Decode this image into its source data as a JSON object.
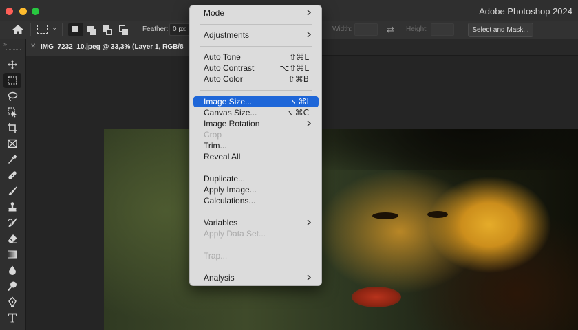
{
  "app": {
    "title": "Adobe Photoshop 2024"
  },
  "options_bar": {
    "feather_label": "Feather:",
    "feather_value": "0 px",
    "width_label": "Width:",
    "height_label": "Height:",
    "select_and_mask": "Select and Mask..."
  },
  "document": {
    "tab_title": "IMG_7232_10.jpeg @ 33,3% (Layer 1, RGB/8"
  },
  "toolbar": {
    "tools": [
      "move-tool",
      "rectangular-marquee-tool",
      "lasso-tool",
      "object-selection-tool",
      "crop-tool",
      "frame-tool",
      "eyedropper-tool",
      "spot-healing-brush-tool",
      "brush-tool",
      "clone-stamp-tool",
      "history-brush-tool",
      "eraser-tool",
      "gradient-tool",
      "blur-tool",
      "dodge-tool",
      "pen-tool",
      "type-tool"
    ],
    "active_tool": "rectangular-marquee-tool"
  },
  "menu": {
    "items": [
      {
        "label": "Mode",
        "submenu": true
      },
      {
        "label": "Adjustments",
        "submenu": true
      },
      {
        "label": "Auto Tone",
        "shortcut": "⇧⌘L"
      },
      {
        "label": "Auto Contrast",
        "shortcut": "⌥⇧⌘L"
      },
      {
        "label": "Auto Color",
        "shortcut": "⇧⌘B"
      },
      {
        "label": "Image Size...",
        "shortcut": "⌥⌘I",
        "highlighted": true
      },
      {
        "label": "Canvas Size...",
        "shortcut": "⌥⌘C"
      },
      {
        "label": "Image Rotation",
        "submenu": true
      },
      {
        "label": "Crop",
        "disabled": true
      },
      {
        "label": "Trim..."
      },
      {
        "label": "Reveal All"
      },
      {
        "label": "Duplicate..."
      },
      {
        "label": "Apply Image..."
      },
      {
        "label": "Calculations..."
      },
      {
        "label": "Variables",
        "submenu": true
      },
      {
        "label": "Apply Data Set...",
        "disabled": true
      },
      {
        "label": "Trap...",
        "disabled": true
      },
      {
        "label": "Analysis",
        "submenu": true
      }
    ]
  }
}
